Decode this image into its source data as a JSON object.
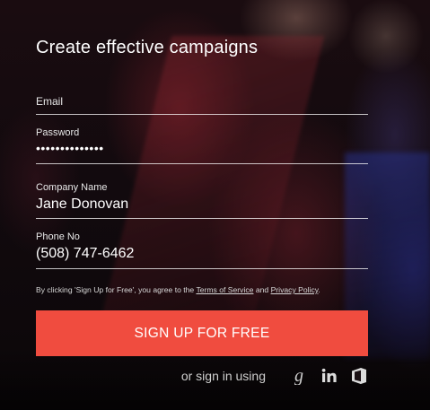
{
  "form": {
    "title": "Create effective campaigns",
    "fields": {
      "email": {
        "label": "Email",
        "value": ""
      },
      "password": {
        "label": "Password",
        "value": "••••••••••••••"
      },
      "company": {
        "label": "Company Name",
        "value": "Jane Donovan"
      },
      "phone": {
        "label": "Phone No",
        "value": "(508) 747-6462"
      }
    },
    "terms": {
      "prefix": "By clicking 'Sign Up for Free', you agree to the ",
      "terms_link": "Terms of Service",
      "and": " and ",
      "privacy_link": "Privacy Policy",
      "suffix": "."
    },
    "signup_button": "SIGN UP FOR FREE",
    "social": {
      "label": "or sign in using",
      "icons": [
        "google-icon",
        "linkedin-icon",
        "office-icon"
      ]
    }
  },
  "colors": {
    "button": "#f04c3f",
    "text": "#ffffff"
  }
}
